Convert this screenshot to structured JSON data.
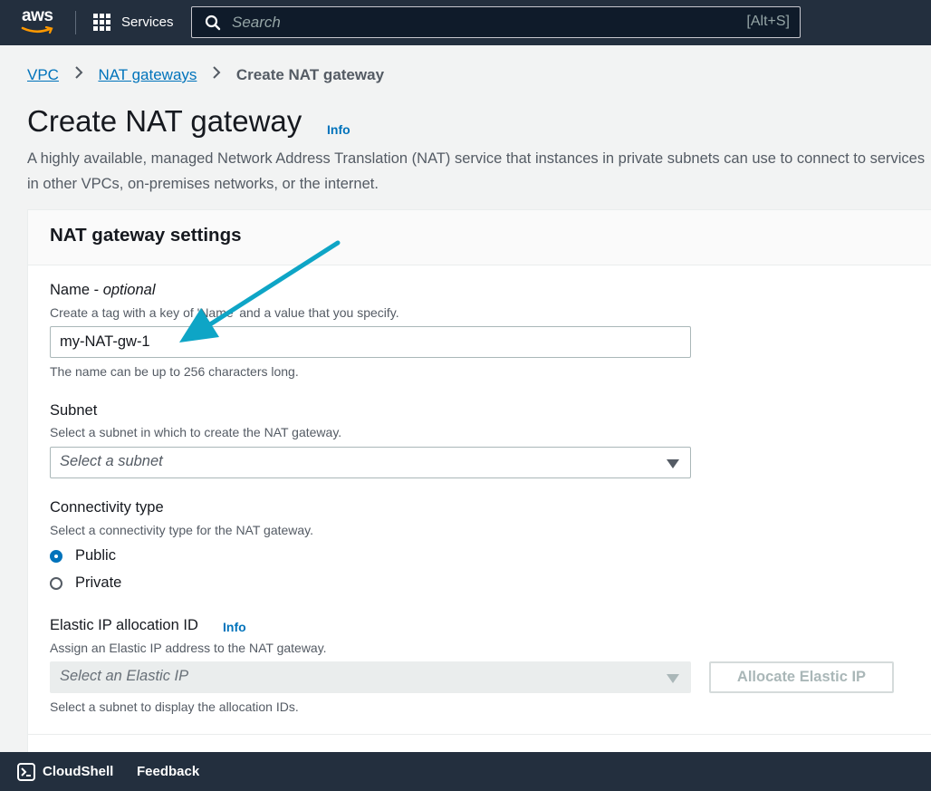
{
  "topnav": {
    "logo_text": "aws",
    "services_label": "Services",
    "search_placeholder": "Search",
    "search_shortcut": "[Alt+S]",
    "colors": {
      "bg": "#232f3e",
      "brand_smile": "#ff9900"
    }
  },
  "breadcrumb": {
    "items": [
      {
        "label": "VPC"
      },
      {
        "label": "NAT gateways"
      }
    ],
    "current": "Create NAT gateway"
  },
  "page": {
    "title": "Create NAT gateway",
    "info_label": "Info",
    "description": "A highly available, managed Network Address Translation (NAT) service that instances in private subnets can use to connect to services in other VPCs, on-premises networks, or the internet."
  },
  "settings": {
    "title": "NAT gateway settings",
    "name": {
      "label": "Name - ",
      "label_optional": "optional",
      "hint": "Create a tag with a key of 'Name' and a value that you specify.",
      "value": "my-NAT-gw-1",
      "constraint": "The name can be up to 256 characters long."
    },
    "subnet": {
      "label": "Subnet",
      "hint": "Select a subnet in which to create the NAT gateway.",
      "selected": "Select a subnet"
    },
    "connectivity": {
      "label": "Connectivity type",
      "hint": "Select a connectivity type for the NAT gateway.",
      "options": [
        {
          "label": "Public",
          "checked": true
        },
        {
          "label": "Private",
          "checked": false
        }
      ]
    },
    "elastic_ip": {
      "label": "Elastic IP allocation ID",
      "info_label": "Info",
      "hint": "Assign an Elastic IP address to the NAT gateway.",
      "selected": "Select an Elastic IP",
      "allocate_button": "Allocate Elastic IP",
      "constraint": "Select a subnet to display the allocation IDs."
    }
  },
  "annotation": {
    "arrow_color": "#0ea5c6"
  },
  "footer": {
    "cloudshell_label": "CloudShell",
    "feedback_label": "Feedback"
  }
}
